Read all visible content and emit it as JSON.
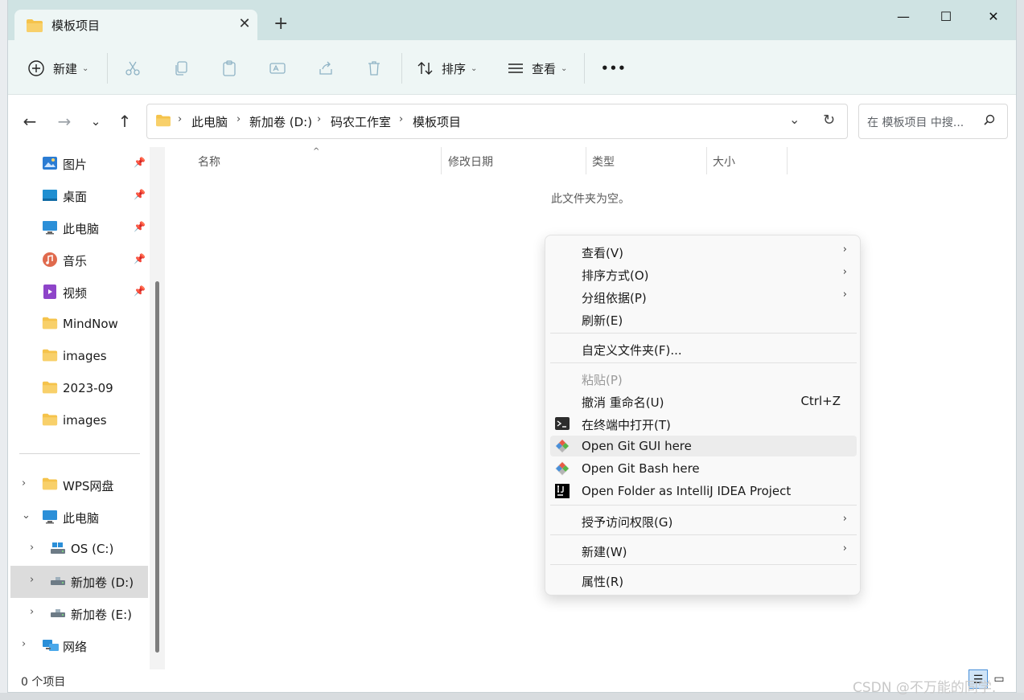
{
  "window": {
    "tab_title": "模板项目",
    "new_tab": "+",
    "minimize": "—",
    "maximize": "☐",
    "close": "✕"
  },
  "toolbar": {
    "new_label": "新建",
    "sort_label": "排序",
    "view_label": "查看",
    "more": "•••"
  },
  "address": {
    "crumbs": [
      "此电脑",
      "新加卷 (D:)",
      "码农工作室",
      "模板项目"
    ],
    "search_placeholder": "在 模板项目 中搜..."
  },
  "sidebar": {
    "quick_access": [
      {
        "label": "图片",
        "icon": "pictures-icon"
      },
      {
        "label": "桌面",
        "icon": "desktop-icon"
      },
      {
        "label": "此电脑",
        "icon": "computer-icon"
      },
      {
        "label": "音乐",
        "icon": "music-icon"
      },
      {
        "label": "视频",
        "icon": "video-icon"
      },
      {
        "label": "MindNow",
        "icon": "folder-icon"
      },
      {
        "label": "images",
        "icon": "folder-icon"
      },
      {
        "label": "2023-09",
        "icon": "folder-icon"
      },
      {
        "label": "images",
        "icon": "folder-icon"
      }
    ],
    "tree": [
      {
        "label": "WPS网盘",
        "icon": "folder-icon"
      },
      {
        "label": "此电脑",
        "icon": "computer-icon"
      },
      {
        "label": "OS (C:)",
        "icon": "drive-icon"
      },
      {
        "label": "新加卷 (D:)",
        "icon": "drive-icon"
      },
      {
        "label": "新加卷 (E:)",
        "icon": "drive-icon"
      },
      {
        "label": "网络",
        "icon": "network-icon"
      }
    ]
  },
  "columns": {
    "name": "名称",
    "modified": "修改日期",
    "type": "类型",
    "size": "大小"
  },
  "content": {
    "empty_message": "此文件夹为空。"
  },
  "context_menu": {
    "view": "查看(V)",
    "sort_by": "排序方式(O)",
    "group_by": "分组依据(P)",
    "refresh": "刷新(E)",
    "customize": "自定义文件夹(F)...",
    "paste": "粘贴(P)",
    "undo_rename": "撤消 重命名(U)",
    "undo_shortcut": "Ctrl+Z",
    "open_terminal": "在终端中打开(T)",
    "git_gui": "Open Git GUI here",
    "git_bash": "Open Git Bash here",
    "intellij": "Open Folder as IntelliJ IDEA Project",
    "give_access": "授予访问权限(G)",
    "new": "新建(W)",
    "properties": "属性(R)"
  },
  "status": {
    "item_count": "0 个项目"
  },
  "watermark": "CSDN @不万能的同学.",
  "colors": {
    "titlebar_bg": "#cfe3e3",
    "toolbar_bg": "#eef6f5",
    "folder_yellow": "#f5c34b",
    "accent_blue": "#4a90d9"
  }
}
